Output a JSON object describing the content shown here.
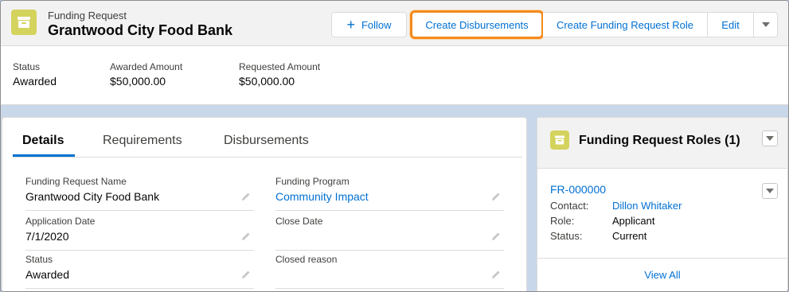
{
  "header": {
    "object_label": "Funding Request",
    "record_title": "Grantwood City Food Bank",
    "icon": "record-box-icon",
    "buttons": {
      "follow": "Follow",
      "create_disbursements": "Create Disbursements",
      "create_role": "Create Funding Request Role",
      "edit": "Edit"
    }
  },
  "highlights": [
    {
      "label": "Status",
      "value": "Awarded"
    },
    {
      "label": "Awarded Amount",
      "value": "$50,000.00"
    },
    {
      "label": "Requested Amount",
      "value": "$50,000.00"
    }
  ],
  "tabs": [
    "Details",
    "Requirements",
    "Disbursements"
  ],
  "details": {
    "fields": [
      {
        "label": "Funding Request Name",
        "value": "Grantwood City Food Bank"
      },
      {
        "label": "Funding Program",
        "value": "Community Impact"
      },
      {
        "label": "Application Date",
        "value": "7/1/2020"
      },
      {
        "label": "Close Date",
        "value": ""
      },
      {
        "label": "Status",
        "value": "Awarded"
      },
      {
        "label": "Closed reason",
        "value": ""
      }
    ]
  },
  "roles_card": {
    "title": "Funding Request Roles (1)",
    "record_link": "FR-000000",
    "rows": [
      {
        "key": "Contact:",
        "value": "Dillon Whitaker"
      },
      {
        "key": "Role:",
        "value": "Applicant"
      },
      {
        "key": "Status:",
        "value": "Current"
      }
    ],
    "view_all": "View All"
  },
  "colors": {
    "accent": "#0070d2",
    "icon_bg": "#d4d35e",
    "highlight_outline": "#f38a1c"
  }
}
